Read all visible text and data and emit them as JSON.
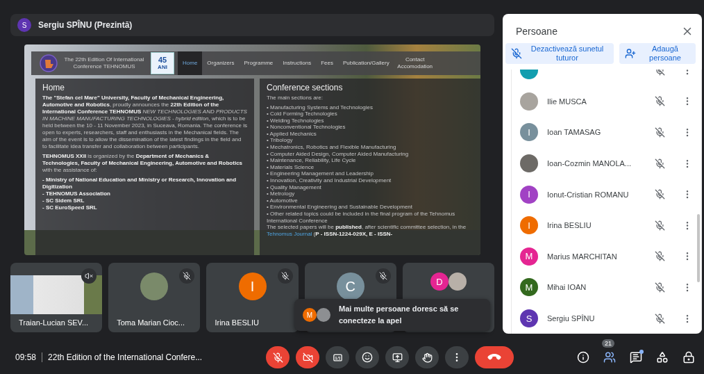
{
  "presenter": {
    "name": "Sergiu SPÎNU (Prezintă)",
    "avatar": {
      "letter": "S",
      "color": "#5e35b1"
    }
  },
  "website": {
    "header": {
      "title": "The 22th Edition Of International Conference TEHNOMUS",
      "badge_number": "45",
      "badge_word": "ANI"
    },
    "nav": [
      {
        "label": "Home",
        "selected": true
      },
      {
        "label": "Organizers",
        "selected": false
      },
      {
        "label": "Programme",
        "selected": false
      },
      {
        "label": "Instructions",
        "selected": false
      },
      {
        "label": "Fees",
        "selected": false
      },
      {
        "label": "Publication/Gallery",
        "selected": false
      },
      {
        "label": "Contact Accomodation",
        "selected": false
      }
    ],
    "home": {
      "title": "Home",
      "paragraphs": [
        "**The \"Stefan cel Mare\" University, Faculty of Mechanical Engineering, Automotive and Robotics**, proudly announces the **22th Edition of the International Conference TEHNOMUS** *NEW TECHNOLOGIES AND PRODUCTS IN MACHINE MANUFACTURING TECHNOLOGIES - hybrid edition*, which is to be held between the 10 - 11 November 2023, in Suceava, Romania. The conference is open to experts, researchers, staff and enthusiasts in the Mechanical fields. The aim of the event is to allow the dissemination of the latest findings in the field and to facilitate idea transfer and collaboration between participants.",
        "**TEHNOMUS XXII** is organized by the **Department of Mechanics & Technologies, Faculty of Mechanical Engineering, Automotive and Robotics** with the assistance of:"
      ],
      "partners": [
        "- Ministry of National Education and Ministry or Research, Innovation and Digitization",
        "- TEHNOMUS Association",
        "- SC Sidem SRL",
        "- SC EuroSpeed SRL"
      ]
    },
    "sections": {
      "title": "Conference sections",
      "intro": "The main sections are:",
      "items": [
        "• Manufacturing Systems and Technologies",
        "• Cold Forming Technologies",
        "• Welding Technologies",
        "• Nonconventional Technologies",
        "• Applied Mechanics",
        "• Tribology",
        "• Mechatronics, Robotics and Flexible Manufacturing",
        "• Computer Aided Design, Computer Aided Manufacturing",
        "• Maintenance, Reliability, Life Cycle",
        "• Materials Science",
        "• Engineering Management and Leadership",
        "• Innovation, Creativity and Industrial Development",
        "• Quality Management",
        "• Metrology",
        "• Automotive",
        "• Environmental Engineering and Sustainable Development",
        "• Other related topics could be included in the final program of the Tehnomus International Conference"
      ],
      "note_before": "The selected papers will be **published**, after scientific committee selection, in the ",
      "note_link": "Tehnomus Journal",
      "note_after": " (**P - ISSN-1224-029X, E - ISSN-**"
    }
  },
  "tiles": [
    {
      "kind": "screen",
      "name": "Traian-Lucian SEV...",
      "muted": true
    },
    {
      "kind": "avatar",
      "name": "Toma Marian Cioc...",
      "muted": true,
      "avatars": [
        {
          "kind": "photo",
          "color": "#7a8a6a"
        }
      ]
    },
    {
      "kind": "avatar",
      "name": "Irina BESLIU",
      "muted": true,
      "avatars": [
        {
          "kind": "letter",
          "letter": "I",
          "color": "#ef6c00"
        }
      ]
    },
    {
      "kind": "avatar",
      "muted": true,
      "avatars": [
        {
          "kind": "letter",
          "letter": "C",
          "color": "#78909c"
        }
      ]
    },
    {
      "kind": "avatar",
      "muted": false,
      "avatars": [
        {
          "kind": "letter",
          "letter": "D",
          "color": "#e52592"
        },
        {
          "kind": "photo",
          "color": "#b8b0a8"
        }
      ]
    }
  ],
  "toast": {
    "text": "Mai multe persoane doresc să se conecteze la apel",
    "avatars": [
      {
        "kind": "letter",
        "letter": "M",
        "color": "#ef6c00"
      },
      {
        "kind": "photo",
        "color": "#8d8f92"
      }
    ]
  },
  "people_panel": {
    "title": "Persoane",
    "mute_all": "Dezactivează sunetul tuturor",
    "add": "Adaugă persoane",
    "participants": [
      {
        "avatar": {
          "kind": "letter",
          "color": "#129eaf"
        },
        "muted": true
      },
      {
        "name": "Ilie MUSCA",
        "avatar": {
          "kind": "photo",
          "color": "#a8a49e"
        },
        "muted": true
      },
      {
        "name": "Ioan TAMASAG",
        "avatar": {
          "kind": "letter",
          "letter": "I",
          "color": "#78909c"
        },
        "muted": true
      },
      {
        "name": "Ioan-Cozmin MANOLA...",
        "avatar": {
          "kind": "photo",
          "color": "#6d6a66"
        },
        "muted": true
      },
      {
        "name": "Ionut-Cristian ROMANU",
        "avatar": {
          "kind": "letter",
          "letter": "I",
          "color": "#a142c4"
        },
        "muted": true
      },
      {
        "name": "Irina BESLIU",
        "avatar": {
          "kind": "letter",
          "letter": "I",
          "color": "#ef6c00"
        },
        "muted": true
      },
      {
        "name": "Marius MARCHITAN",
        "avatar": {
          "kind": "letter",
          "letter": "M",
          "color": "#e52592"
        },
        "muted": true
      },
      {
        "name": "Mihai IOAN",
        "avatar": {
          "kind": "letter",
          "letter": "M",
          "color": "#33691e"
        },
        "muted": true
      },
      {
        "name": "Sergiu SPÎNU",
        "avatar": {
          "kind": "letter",
          "letter": "S",
          "color": "#5e35b1"
        },
        "muted": true
      }
    ]
  },
  "bottom_bar": {
    "time": "09:58",
    "meeting_title": "22th Edition of the International Confere...",
    "controls": [
      {
        "kind": "mic",
        "off": true
      },
      {
        "kind": "camera",
        "off": true
      },
      {
        "kind": "captions"
      },
      {
        "kind": "emoji"
      },
      {
        "kind": "present"
      },
      {
        "kind": "hand"
      },
      {
        "kind": "more"
      },
      {
        "kind": "end_call"
      }
    ],
    "side_buttons": [
      {
        "kind": "info",
        "selected": false
      },
      {
        "kind": "people",
        "selected": true,
        "badge": "21"
      },
      {
        "kind": "chat",
        "selected": false,
        "notification": true
      },
      {
        "kind": "activities",
        "selected": false
      },
      {
        "kind": "host_controls",
        "selected": false
      }
    ]
  }
}
